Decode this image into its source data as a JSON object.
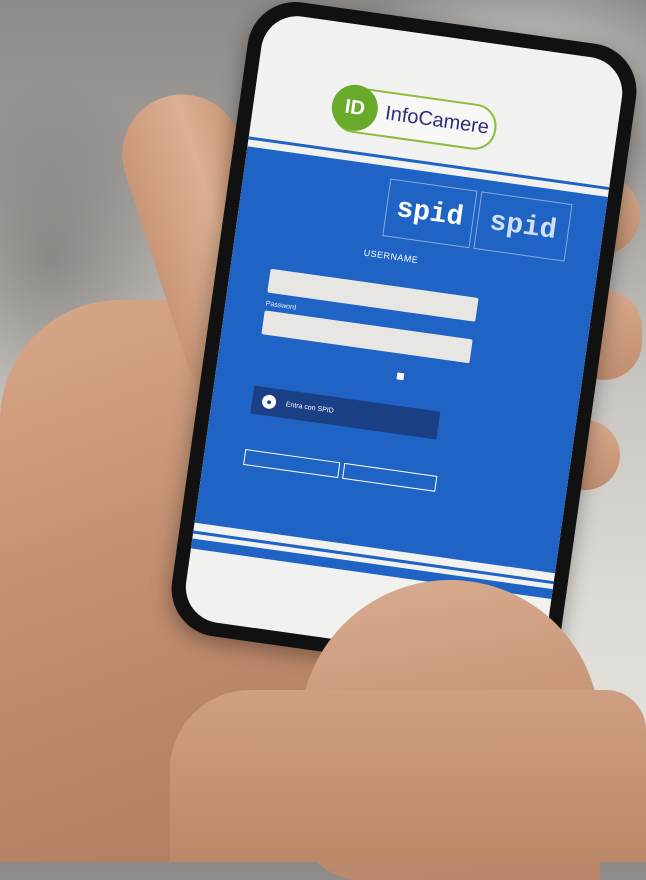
{
  "logo": {
    "badge": "ID",
    "name": "InfoCamere"
  },
  "spid_tabs": [
    {
      "small": "",
      "brand": "spid"
    },
    {
      "small": "",
      "brand": "spid"
    }
  ],
  "login": {
    "title": "USERNAME",
    "username_label": "",
    "username_value": "",
    "password_label": "Password",
    "password_value": "",
    "remember_label": "",
    "spid_button_label": "Entra con SPID"
  },
  "colors": {
    "panel_blue": "#1f63c4",
    "button_navy": "#1b3f84",
    "logo_green": "#6aaa2b",
    "logo_text": "#2d2f7a"
  }
}
